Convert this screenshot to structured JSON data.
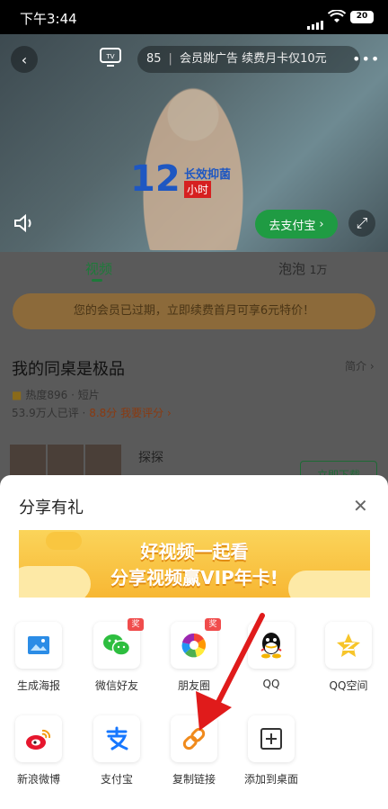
{
  "status_bar": {
    "time": "下午3:44",
    "battery": "20"
  },
  "video": {
    "ad_count": "85",
    "ad_text": "会员跳广告 续费月卡仅10元",
    "promo_number": "12",
    "promo_text": "长效抑菌",
    "promo_sub": "小时",
    "pay_button": "去支付宝"
  },
  "tabs": [
    {
      "label": "视频"
    },
    {
      "label": "泡泡",
      "count": "1万"
    }
  ],
  "vip_banner": "您的会员已过期，立即续费首月可享6元特价！",
  "show": {
    "title": "我的同桌是极品",
    "intro_link": "简介",
    "heat": "热度896",
    "genre": "短片",
    "followers": "53.9万人已评",
    "score": "8.8分",
    "rate_link": "我要评分",
    "episode_label": "探探",
    "download_button": "立即下载"
  },
  "share_sheet": {
    "title": "分享有礼",
    "banner_line1": "好视频一起看",
    "banner_line2": "分享视频赢VIP年卡!",
    "items": [
      {
        "label": "生成海报",
        "icon": "poster-icon"
      },
      {
        "label": "微信好友",
        "icon": "wechat-icon",
        "badge": "奖"
      },
      {
        "label": "朋友圈",
        "icon": "moments-icon",
        "badge": "奖"
      },
      {
        "label": "QQ",
        "icon": "qq-icon"
      },
      {
        "label": "QQ空间",
        "icon": "qzone-icon"
      },
      {
        "label": "新浪微博",
        "icon": "weibo-icon"
      },
      {
        "label": "支付宝",
        "icon": "alipay-icon"
      },
      {
        "label": "复制链接",
        "icon": "link-icon"
      },
      {
        "label": "添加到桌面",
        "icon": "add-desktop-icon"
      }
    ]
  },
  "colors": {
    "accent_green": "#1f9b43",
    "weibo_red": "#e6162d",
    "alipay_blue": "#1677ff",
    "link_orange": "#f08a1c",
    "annotation_red": "#e01b1b"
  }
}
